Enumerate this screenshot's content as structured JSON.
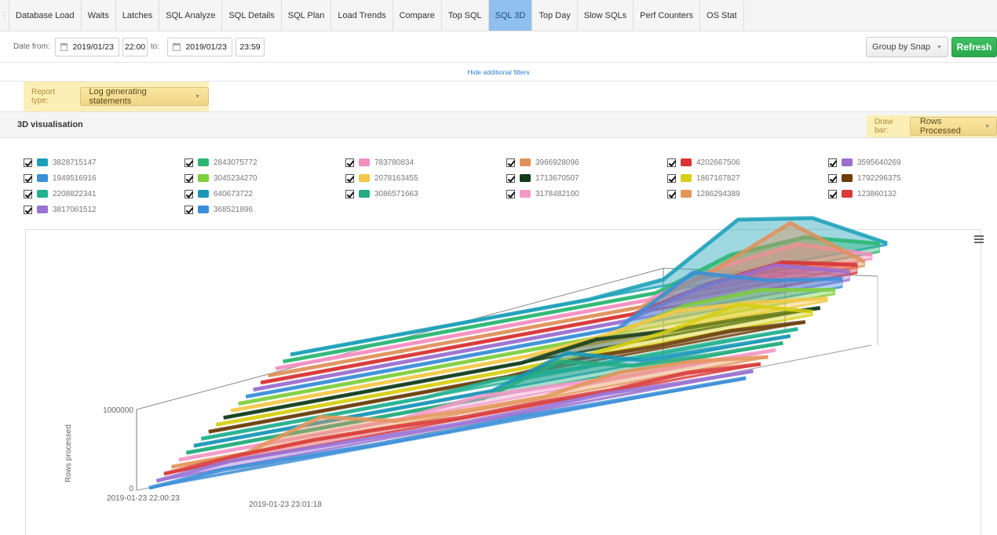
{
  "tabs": [
    "Database Load",
    "Waits",
    "Latches",
    "SQL Analyze",
    "SQL Details",
    "SQL Plan",
    "Load Trends",
    "Compare",
    "Top SQL",
    "SQL 3D",
    "Top Day",
    "Slow SQLs",
    "Perf Counters",
    "OS Stat"
  ],
  "active_tab": "SQL 3D",
  "toolbar": {
    "date_from_label": "Date from:",
    "date_from": "2019/01/23",
    "time_from": "22:00",
    "to_label": "to:",
    "date_to": "2019/01/23",
    "time_to": "23:59",
    "group_by": "Group by Snap",
    "refresh": "Refresh"
  },
  "filters_link": "Hide additional filters",
  "report": {
    "label": "Report type:",
    "value": "Log generating statements"
  },
  "section": {
    "title": "3D visualisation",
    "draw_bar_label": "Draw bar:",
    "draw_bar_value": "Rows Processed"
  },
  "legend": [
    {
      "id": "3828715147",
      "color": "#1aa0b8"
    },
    {
      "id": "2843075772",
      "color": "#2bb673"
    },
    {
      "id": "783780834",
      "color": "#f48fc1"
    },
    {
      "id": "3966928096",
      "color": "#e0915a"
    },
    {
      "id": "4202667506",
      "color": "#d93333"
    },
    {
      "id": "3595640269",
      "color": "#9b6fd0"
    },
    {
      "id": "1949516916",
      "color": "#3a8fd8"
    },
    {
      "id": "3045234270",
      "color": "#7fcf3f"
    },
    {
      "id": "2078163455",
      "color": "#f5c84a"
    },
    {
      "id": "1713670507",
      "color": "#123d1a"
    },
    {
      "id": "1867167827",
      "color": "#d7cf14"
    },
    {
      "id": "1792296375",
      "color": "#6b3d0a"
    },
    {
      "id": "2208822341",
      "color": "#22b08f"
    },
    {
      "id": "640673722",
      "color": "#1997b8"
    },
    {
      "id": "3086571663",
      "color": "#24ad7e"
    },
    {
      "id": "3178482100",
      "color": "#f29ac8"
    },
    {
      "id": "1286294389",
      "color": "#e4955c"
    },
    {
      "id": "123860132",
      "color": "#d93b3b"
    },
    {
      "id": "3817061512",
      "color": "#9a72d3"
    },
    {
      "id": "368521896",
      "color": "#3b8ed8"
    }
  ],
  "chart_data": {
    "type": "area",
    "title": "",
    "ylabel": "Rows processed",
    "ylim": [
      0,
      1000000
    ],
    "y_ticks": [
      0,
      1000000
    ],
    "x_ticks": [
      "2019-01-23 22:00:23",
      "2019-01-23 23:01:18"
    ],
    "series_count": 20,
    "points_per_series": 9,
    "series": [
      {
        "name": "3828715147",
        "values": [
          0,
          0,
          0,
          0,
          0,
          80000,
          650000,
          500000,
          20000
        ]
      },
      {
        "name": "2843075772",
        "values": [
          0,
          0,
          0,
          0,
          0,
          0,
          300000,
          350000,
          100000
        ]
      },
      {
        "name": "783780834",
        "values": [
          0,
          0,
          0,
          0,
          0,
          0,
          250000,
          350000,
          50000
        ]
      },
      {
        "name": "3966928096",
        "values": [
          0,
          0,
          0,
          0,
          0,
          0,
          300000,
          700000,
          50000
        ]
      },
      {
        "name": "4202667506",
        "values": [
          0,
          0,
          0,
          0,
          0,
          0,
          200000,
          300000,
          100000
        ]
      },
      {
        "name": "3595640269",
        "values": [
          0,
          0,
          0,
          0,
          0,
          0,
          250000,
          350000,
          100000
        ]
      },
      {
        "name": "1949516916",
        "values": [
          0,
          0,
          0,
          0,
          0,
          0,
          520000,
          250000,
          100000
        ]
      },
      {
        "name": "3045234270",
        "values": [
          0,
          0,
          0,
          0,
          0,
          0,
          200000,
          220000,
          50000
        ]
      },
      {
        "name": "2078163455",
        "values": [
          0,
          0,
          0,
          0,
          0,
          80000,
          220000,
          150000,
          30000
        ]
      },
      {
        "name": "1713670507",
        "values": [
          0,
          0,
          0,
          0,
          0,
          120000,
          60000,
          40000,
          0
        ]
      },
      {
        "name": "1867167827",
        "values": [
          0,
          0,
          0,
          0,
          0,
          20000,
          120000,
          300000,
          40000
        ]
      },
      {
        "name": "1792296375",
        "values": [
          0,
          0,
          0,
          0,
          0,
          60000,
          40000,
          60000,
          0
        ]
      },
      {
        "name": "2208822341",
        "values": [
          0,
          0,
          0,
          0,
          60000,
          20000,
          20000,
          20000,
          0
        ]
      },
      {
        "name": "640673722",
        "values": [
          0,
          0,
          0,
          0,
          0,
          300000,
          40000,
          20000,
          0
        ]
      },
      {
        "name": "3086571663",
        "values": [
          0,
          0,
          0,
          0,
          0,
          280000,
          60000,
          20000,
          0
        ]
      },
      {
        "name": "3178482100",
        "values": [
          0,
          0,
          0,
          0,
          100000,
          60000,
          20000,
          20000,
          0
        ]
      },
      {
        "name": "1286294389",
        "values": [
          0,
          0,
          280000,
          60000,
          30000,
          20000,
          150000,
          120000,
          0
        ]
      },
      {
        "name": "123860132",
        "values": [
          0,
          60000,
          80000,
          60000,
          20000,
          30000,
          20000,
          60000,
          0
        ]
      },
      {
        "name": "3817061512",
        "values": [
          0,
          80000,
          60000,
          40000,
          20000,
          30000,
          60000,
          20000,
          0
        ]
      },
      {
        "name": "368521896",
        "values": [
          0,
          60000,
          40000,
          20000,
          20000,
          40000,
          20000,
          10000,
          0
        ]
      }
    ]
  }
}
